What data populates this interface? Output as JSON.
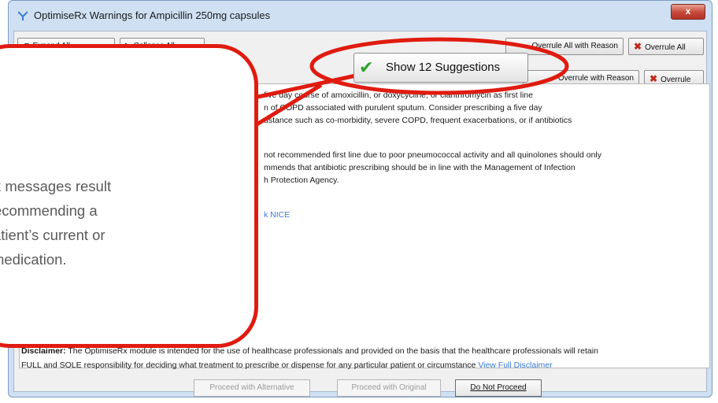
{
  "window": {
    "title": "OptimiseRx Warnings for Ampicillin 250mg capsules",
    "close_label": "x"
  },
  "toolbar": {
    "expand_all": "▼ Expand All",
    "collapse_all": "▶ Collapse All",
    "override_all_with_reason": "Overrule All with Reason",
    "overrule_all": "Overrule All"
  },
  "warning_row": {
    "overrule_with_reason": "Overrule with Reason",
    "overrule": "Overrule"
  },
  "suggestions_button": {
    "label": "Show 12 Suggestions"
  },
  "content": {
    "para1": [
      "five day course of amoxicillin, or doxycycline, or clarithromycin as first line",
      "n of COPD associated with purulent sputum. Consider prescribing a five day",
      "ustance such as co-morbidity, severe COPD, frequent exacerbations, or if antibiotics"
    ],
    "para2": [
      "not recommended first line due to poor pneumococcal activity and all quinolones should only",
      "mmends that antibiotic prescribing should be in line with the Management of Infection",
      "h Protection Agency."
    ],
    "link": "k  NICE"
  },
  "callout": {
    "lines": [
      "iseRx messages result",
      "em recommending a",
      "he patient’s current or",
      "sed medication."
    ]
  },
  "disclaimer": {
    "bold_label": "Disclaimer:",
    "text_line1": " The OptimiseRx module is intended for the use of healthcase professionals and provided on the basis that the healthcare professionals will retain",
    "text_line2": "FULL and SOLE responsibility for deciding what treatment to prescribe or dispense for any particular patient or circumstance ",
    "link": "View Full Disclaimer"
  },
  "footer_buttons": {
    "proceed_alternative": "Proceed with Alternative",
    "proceed_original": "Proceed with Original",
    "do_not_proceed": "Do Not Proceed"
  },
  "colors": {
    "highlight_red": "#e01b10",
    "link_blue": "#3a7bd5",
    "check_green": "#33a02c"
  }
}
